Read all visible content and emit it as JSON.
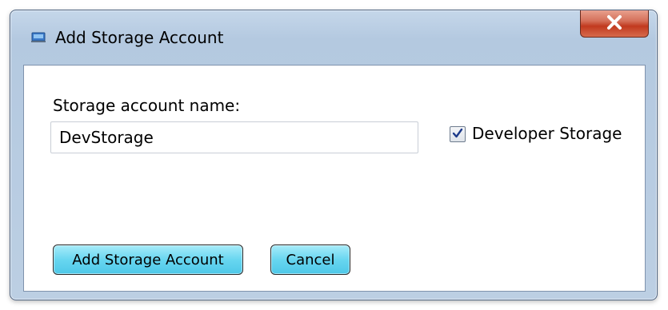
{
  "window": {
    "title": "Add Storage Account",
    "close_symbol": "X",
    "icon": "window-app-icon"
  },
  "form": {
    "account_name_label": "Storage account name:",
    "account_name_value": "DevStorage",
    "developer_storage_label": "Developer Storage",
    "developer_storage_checked": true
  },
  "buttons": {
    "add_label": "Add Storage Account",
    "cancel_label": "Cancel"
  },
  "colors": {
    "button_fill": "#68d6f0",
    "close_button": "#c13a1f",
    "frame": "#bccfe3"
  }
}
